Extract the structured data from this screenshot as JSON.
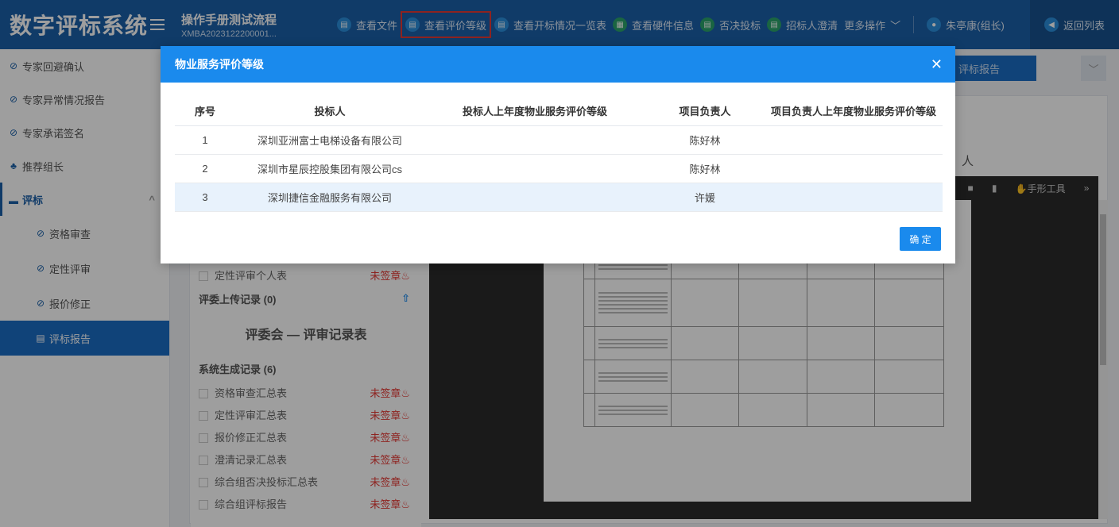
{
  "header": {
    "logo": "数字评标系统",
    "project_title": "操作手册测试流程",
    "project_code": "XMBA2023122200001...",
    "toolbar": [
      {
        "label": "查看文件",
        "icon": "file-icon"
      },
      {
        "label": "查看评价等级",
        "icon": "file-icon",
        "active": true
      },
      {
        "label": "查看开标情况一览表",
        "icon": "file-icon"
      },
      {
        "label": "查看硬件信息",
        "icon": "grid-icon"
      },
      {
        "label": "否决投标",
        "icon": "file-icon"
      },
      {
        "label": "招标人澄清",
        "icon": "file-icon"
      }
    ],
    "more": "更多操作",
    "user": "朱亭康(组长)",
    "back": "返回列表"
  },
  "sidebar": {
    "items": [
      {
        "label": "专家回避确认"
      },
      {
        "label": "专家异常情况报告"
      },
      {
        "label": "专家承诺签名"
      },
      {
        "label": "推荐组长"
      },
      {
        "label": "评标"
      },
      {
        "label": "资格审查"
      },
      {
        "label": "定性评审"
      },
      {
        "label": "报价修正"
      },
      {
        "label": "评标报告"
      }
    ]
  },
  "background": {
    "report_tab": "评标报告",
    "side_text": "人",
    "doc_tool": "手形工具",
    "personal_table": "定性评审个人表",
    "unsigned": "未签章",
    "upload_records": "评委上传记录 (0)",
    "committee_title": "评委会 — 评审记录表",
    "system_records": "系统生成记录 (6)",
    "records": [
      "资格审查汇总表",
      "定性评审汇总表",
      "报价修正汇总表",
      "澄清记录汇总表",
      "综合组否决投标汇总表",
      "综合组评标报告"
    ]
  },
  "modal": {
    "title": "物业服务评价等级",
    "columns": [
      "序号",
      "投标人",
      "投标人上年度物业服务评价等级",
      "项目负责人",
      "项目负责人上年度物业服务评价等级"
    ],
    "rows": [
      {
        "no": "1",
        "bidder": "深圳亚洲富士电梯设备有限公司",
        "bidder_grade": "",
        "manager": "陈好林",
        "manager_grade": ""
      },
      {
        "no": "2",
        "bidder": "深圳市星辰控股集团有限公司cs",
        "bidder_grade": "",
        "manager": "陈好林",
        "manager_grade": ""
      },
      {
        "no": "3",
        "bidder": "深圳捷信金融服务有限公司",
        "bidder_grade": "",
        "manager": "许媛",
        "manager_grade": ""
      }
    ],
    "confirm": "确 定"
  }
}
